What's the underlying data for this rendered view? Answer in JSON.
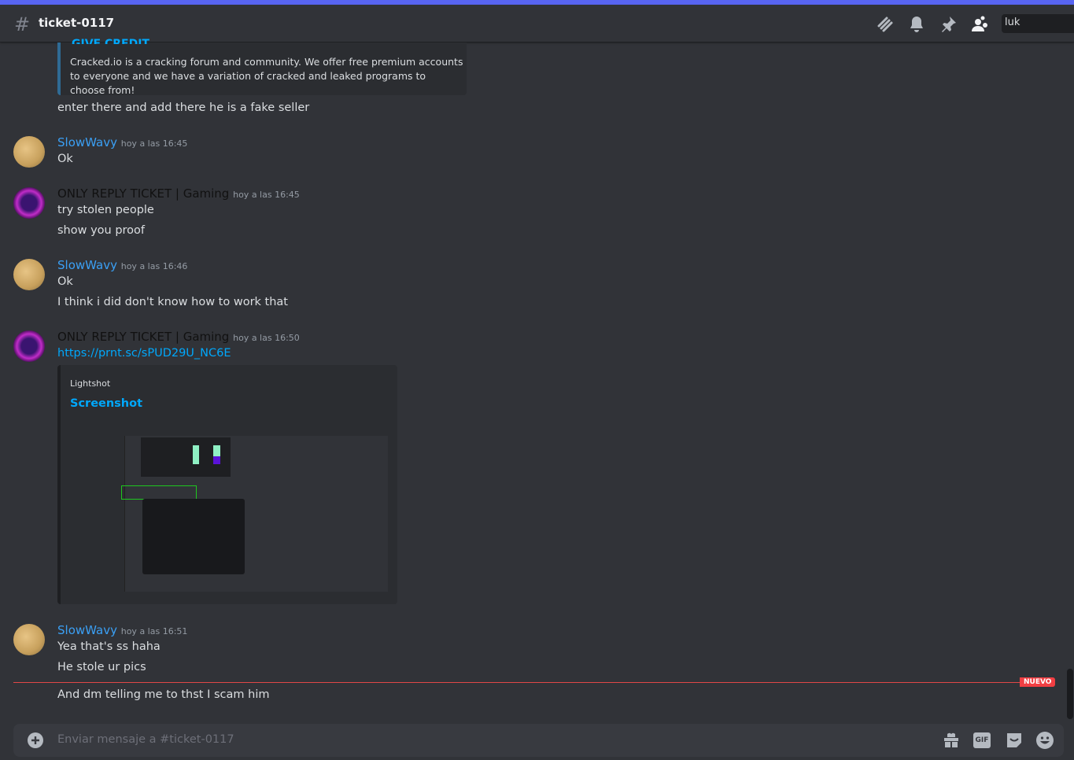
{
  "header": {
    "channel": "ticket-0117",
    "search_value": "luk",
    "icons": [
      "threads-icon",
      "bell-icon",
      "pin-icon",
      "members-icon"
    ]
  },
  "embed1": {
    "title_fragment": "GIVE CREDIT",
    "description": "Cracked.io is a cracking forum and community. We offer free premium accounts to everyone and we have a variation of cracked and leaked programs to choose from!"
  },
  "messages": [
    {
      "text": "enter there and add there he is a fake seller"
    },
    {
      "author": "SlowWavy",
      "time": "hoy a las 16:45",
      "lines": [
        "Ok"
      ]
    },
    {
      "author": "ONLY REPLY TICKET | Gaming",
      "time": "hoy a las 16:45",
      "lines": [
        "try stolen people",
        "show you proof"
      ]
    },
    {
      "author": "SlowWavy",
      "time": "hoy a las 16:46",
      "lines": [
        "Ok",
        "I think i did don't know how to work that"
      ]
    },
    {
      "author": "ONLY REPLY TICKET | Gaming",
      "time": "hoy a las 16:50",
      "link": "https://prnt.sc/sPUD29U_NC6E",
      "embed": {
        "provider": "Lightshot",
        "title": "Screenshot"
      }
    },
    {
      "author": "SlowWavy",
      "time": "hoy a las 16:51",
      "lines": [
        "Yea that's ss haha",
        "He stole ur pics",
        "And dm telling me to thst I scam him"
      ]
    }
  ],
  "new_divider": "NUEVO",
  "composer": {
    "placeholder": "Enviar mensaje a #ticket-0117",
    "icons": [
      "gift-icon",
      "gif-icon",
      "sticker-icon",
      "emoji-icon"
    ],
    "gif_label": "GIF"
  },
  "colors": {
    "accent": "#5865f2",
    "link": "#00a8fc",
    "username": "#3ba0f5",
    "new": "#f23f43"
  }
}
